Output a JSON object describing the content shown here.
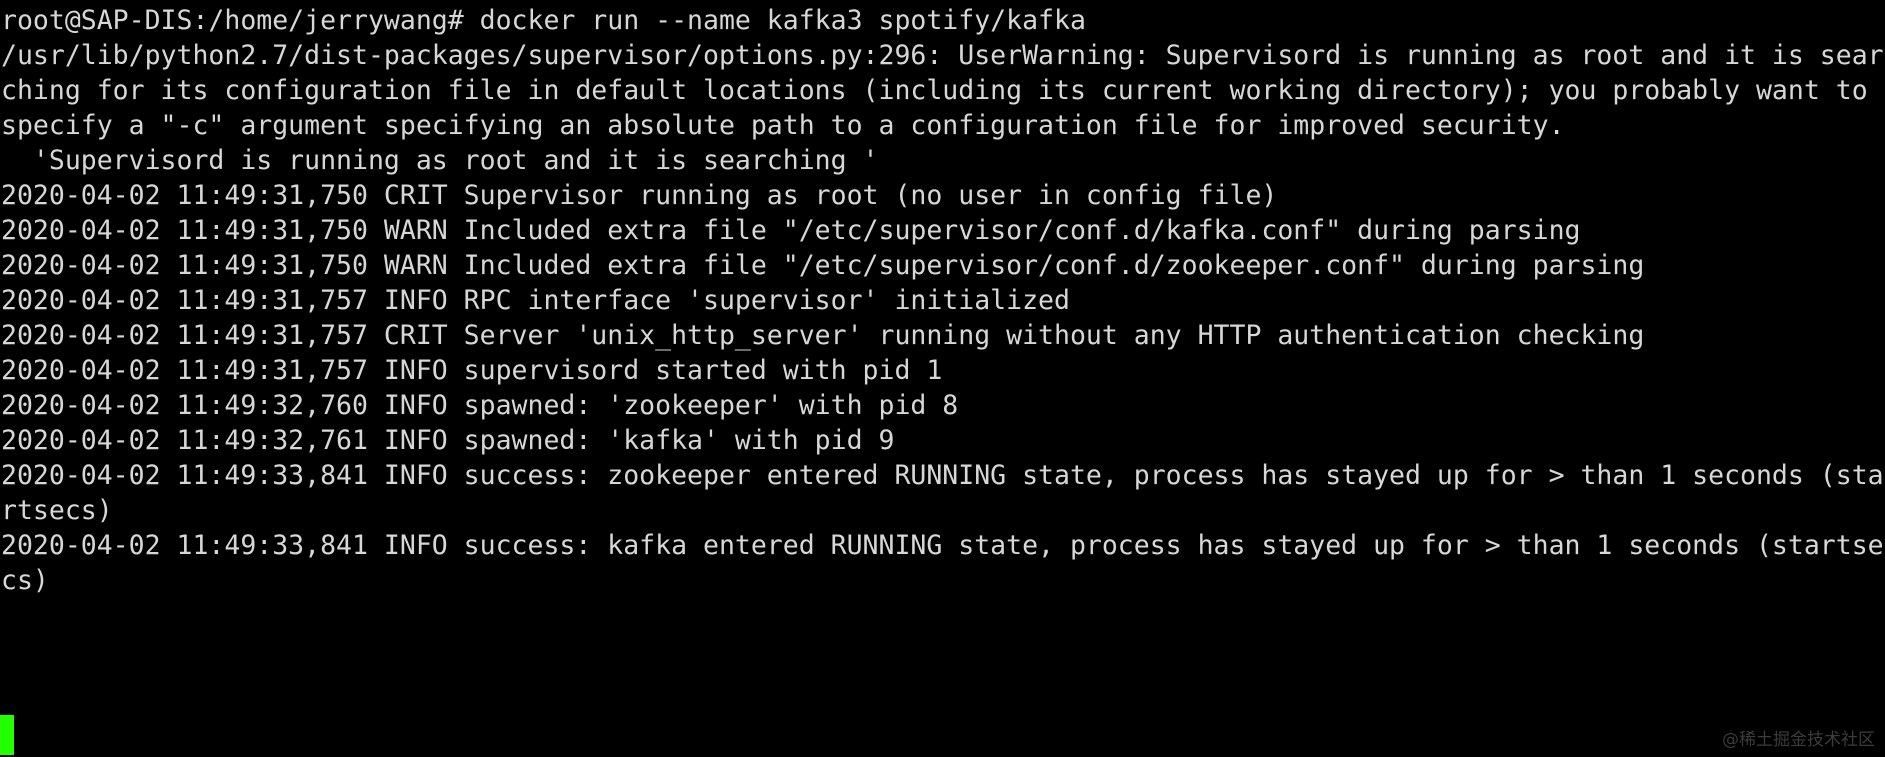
{
  "terminal": {
    "lines": [
      "root@SAP-DIS:/home/jerrywang# docker run --name kafka3 spotify/kafka",
      "/usr/lib/python2.7/dist-packages/supervisor/options.py:296: UserWarning: Supervisord is running as root and it is sear",
      "ching for its configuration file in default locations (including its current working directory); you probably want to",
      "specify a \"-c\" argument specifying an absolute path to a configuration file for improved security.",
      "  'Supervisord is running as root and it is searching '",
      "2020-04-02 11:49:31,750 CRIT Supervisor running as root (no user in config file)",
      "2020-04-02 11:49:31,750 WARN Included extra file \"/etc/supervisor/conf.d/kafka.conf\" during parsing",
      "2020-04-02 11:49:31,750 WARN Included extra file \"/etc/supervisor/conf.d/zookeeper.conf\" during parsing",
      "2020-04-02 11:49:31,757 INFO RPC interface 'supervisor' initialized",
      "2020-04-02 11:49:31,757 CRIT Server 'unix_http_server' running without any HTTP authentication checking",
      "2020-04-02 11:49:31,757 INFO supervisord started with pid 1",
      "2020-04-02 11:49:32,760 INFO spawned: 'zookeeper' with pid 8",
      "2020-04-02 11:49:32,761 INFO spawned: 'kafka' with pid 9",
      "2020-04-02 11:49:33,841 INFO success: zookeeper entered RUNNING state, process has stayed up for > than 1 seconds (sta",
      "rtsecs)",
      "2020-04-02 11:49:33,841 INFO success: kafka entered RUNNING state, process has stayed up for > than 1 seconds (startse",
      "cs)"
    ],
    "cursor_color": "#22ff00",
    "text_color": "#d7d7d7",
    "background_color": "#000000"
  },
  "watermark": "@稀土掘金技术社区"
}
